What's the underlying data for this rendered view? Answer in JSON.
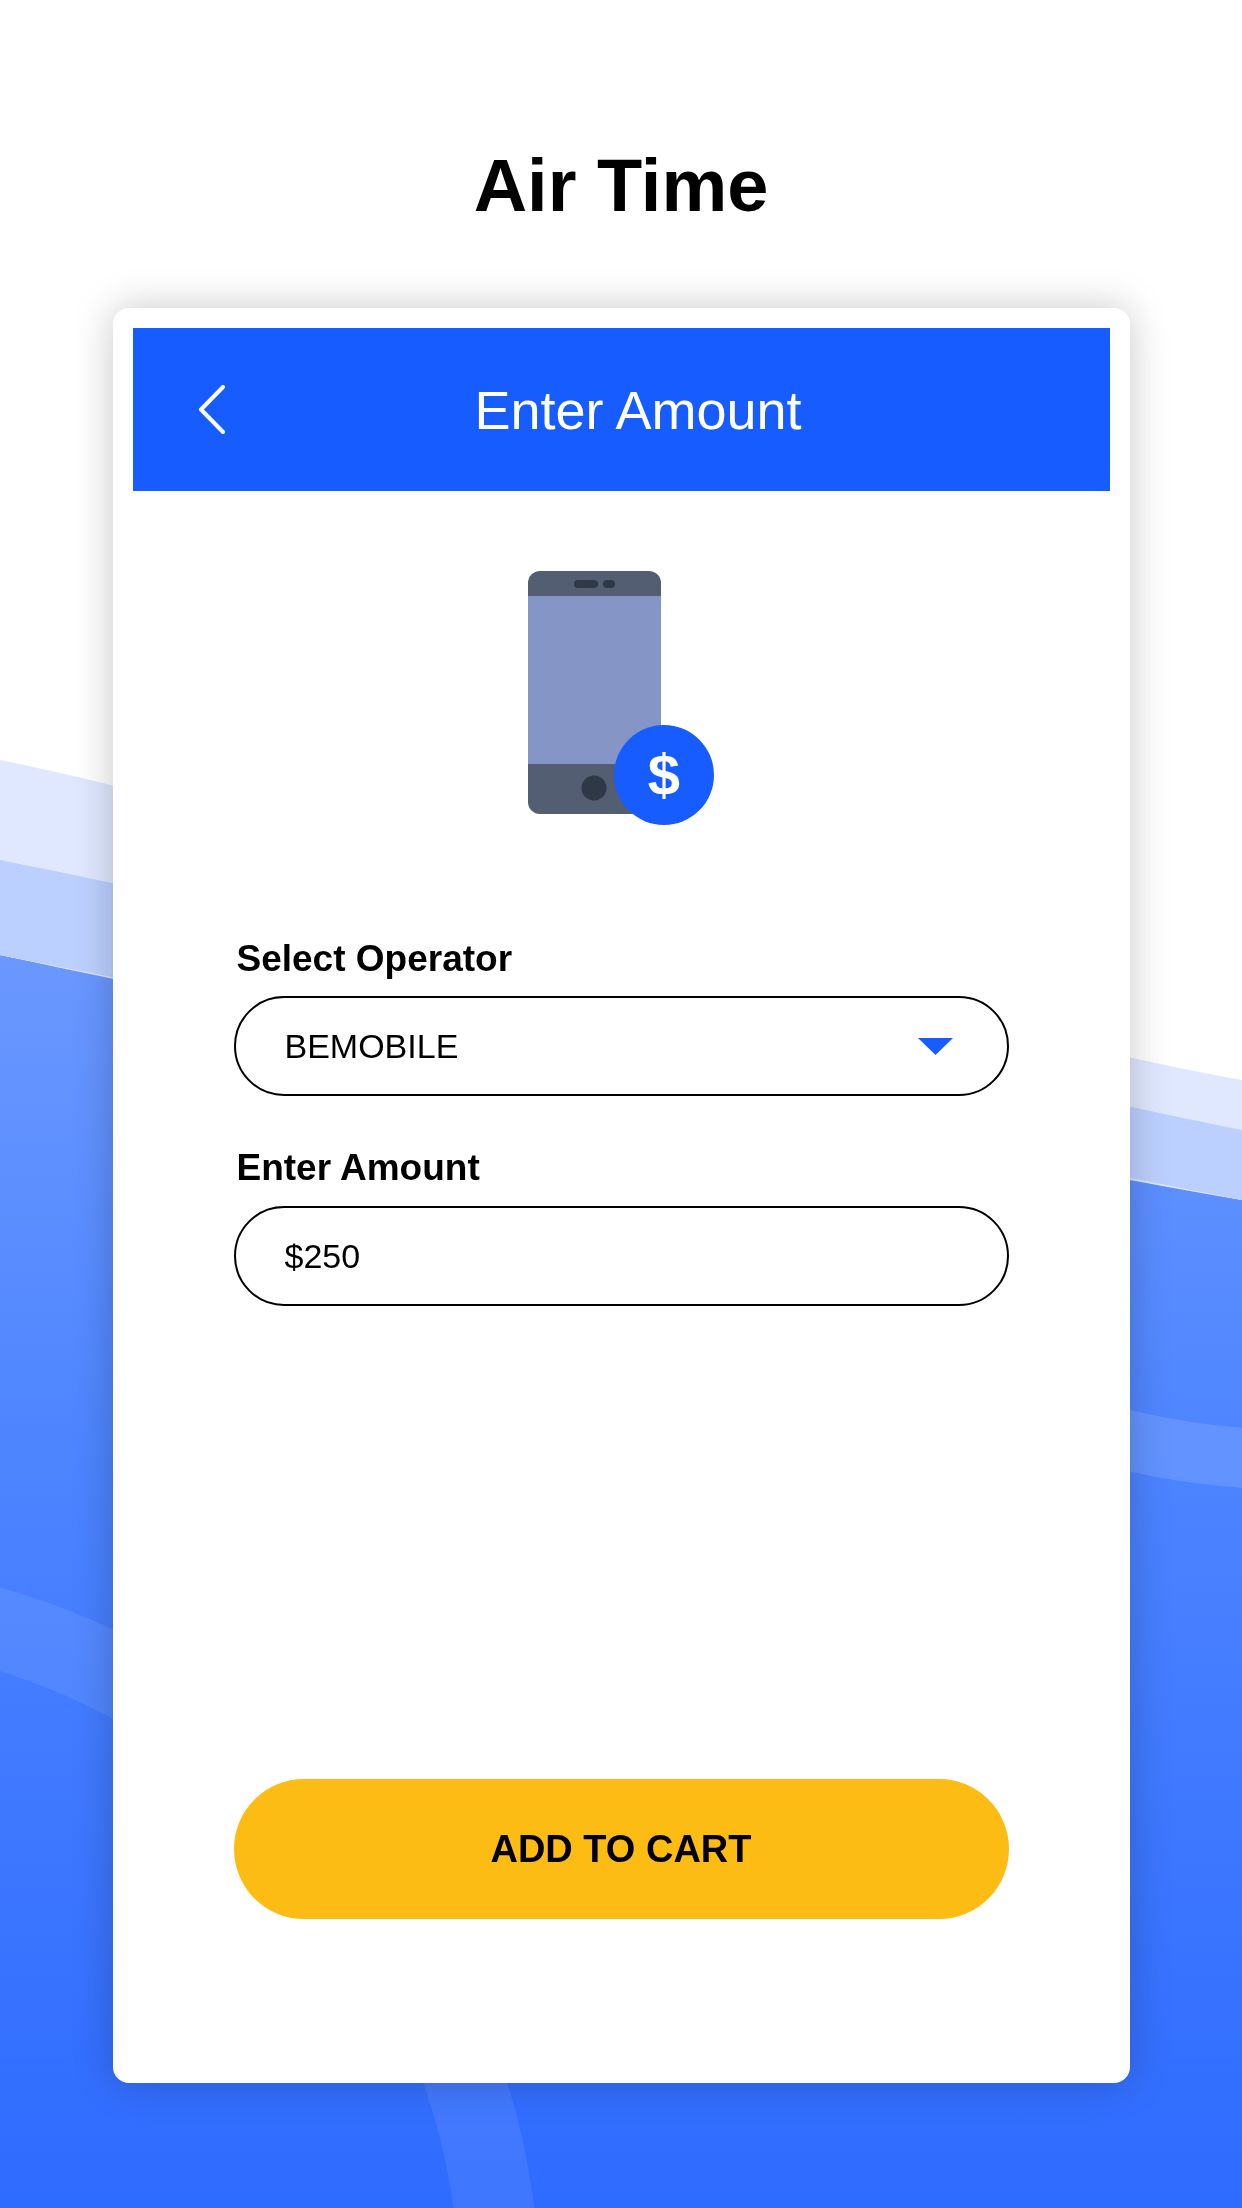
{
  "page_title": "Air Time",
  "header": {
    "title": "Enter Amount"
  },
  "illustration": {
    "badge": "$"
  },
  "form": {
    "fields": [
      {
        "kind": "select",
        "label": "Select Operator",
        "value": "BEMOBILE"
      },
      {
        "kind": "input",
        "label": "Enter Amount",
        "value": "$250"
      }
    ]
  },
  "button": {
    "label": "ADD TO CART"
  }
}
